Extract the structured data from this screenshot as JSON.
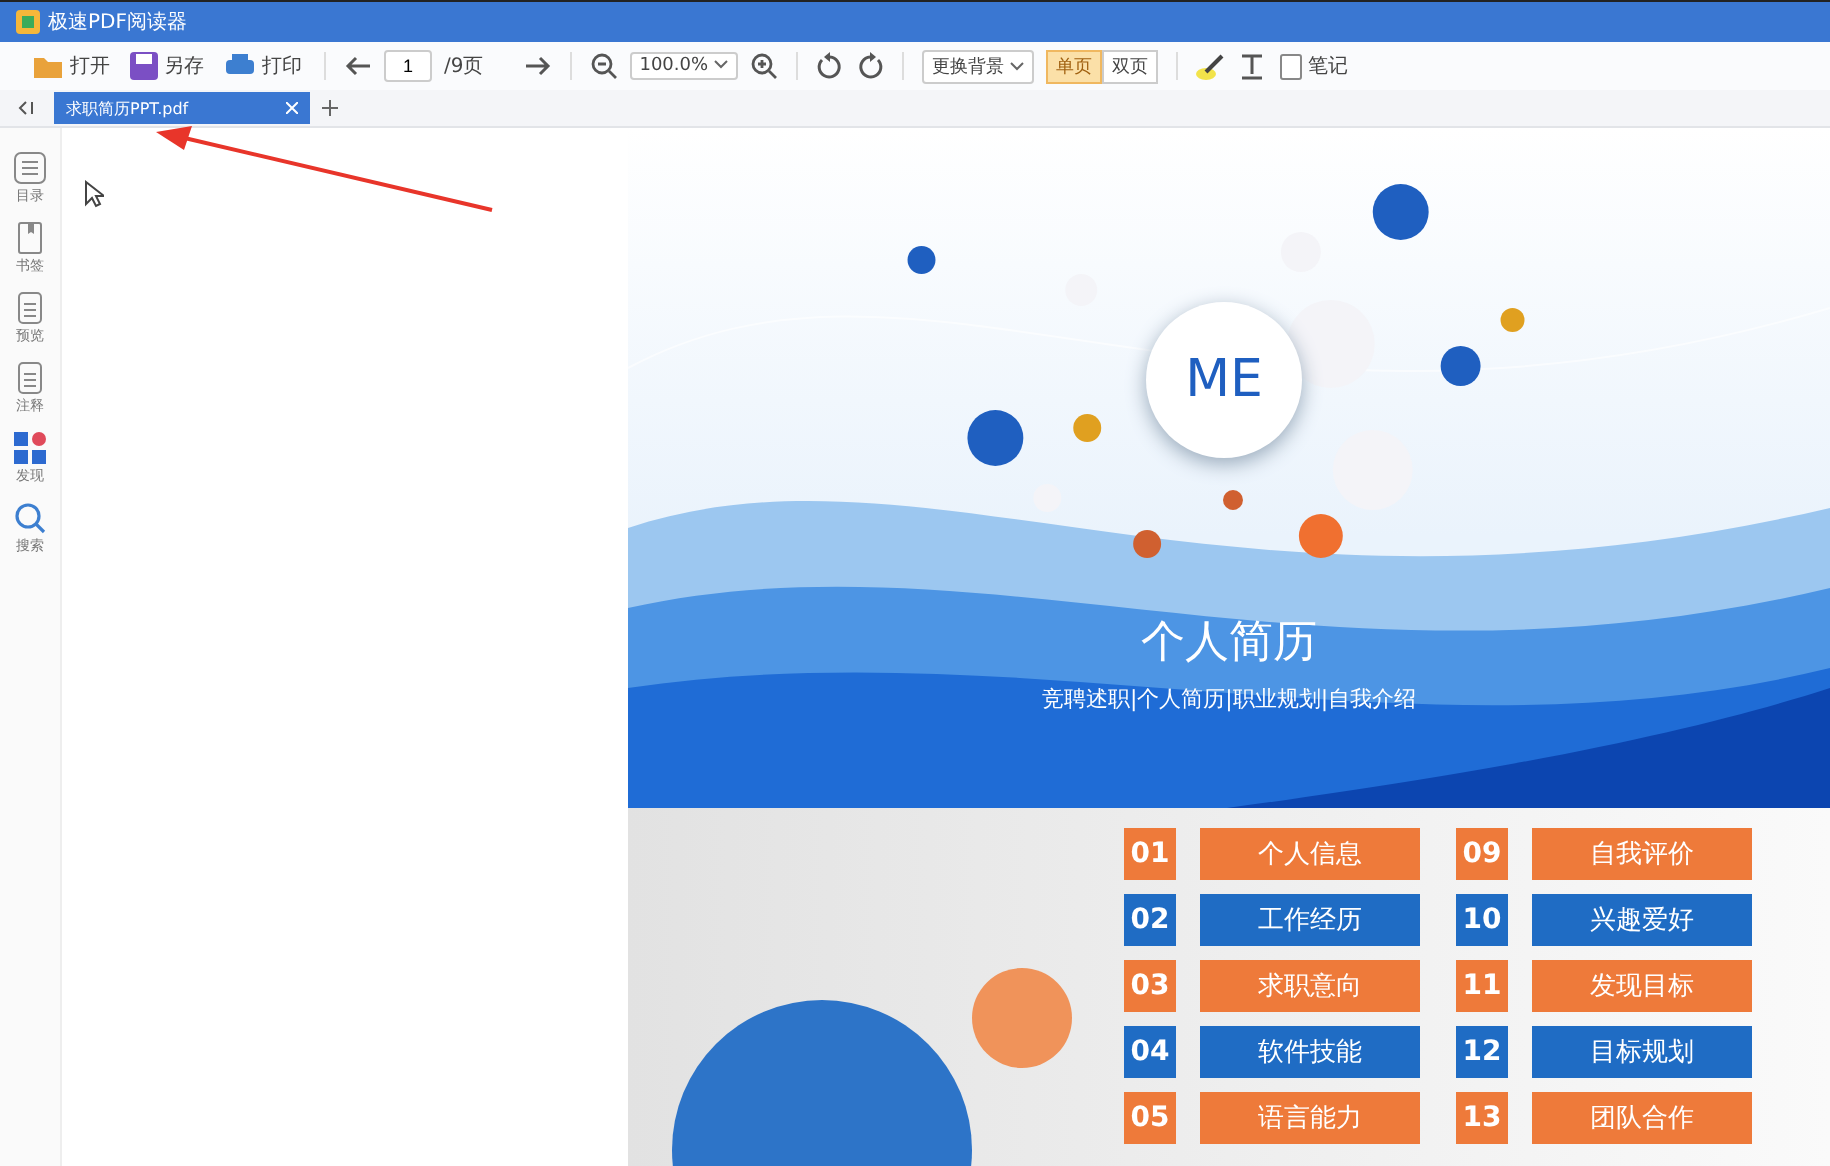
{
  "window": {
    "title": "极速PDF阅读器"
  },
  "toolbar": {
    "buttons": [
      {
        "kind": "open",
        "label": "打开"
      },
      {
        "kind": "save",
        "label": "另存"
      },
      {
        "kind": "print",
        "label": "打印"
      }
    ],
    "page": "1",
    "page_total": "/9页",
    "zoom": "100.0%",
    "background": "更换背景",
    "view_modes": [
      {
        "label": "单页",
        "selected": true
      },
      {
        "label": "双页",
        "selected": false
      }
    ],
    "note": "笔记"
  },
  "tabs": [
    {
      "label": "求职简历PPT.pdf",
      "selected": true
    }
  ],
  "sidebar": {
    "items": [
      {
        "kind": "toc",
        "label": "目录"
      },
      {
        "kind": "bookmark",
        "label": "书签"
      },
      {
        "kind": "preview",
        "label": "预览"
      },
      {
        "kind": "note",
        "label": "注释"
      },
      {
        "kind": "apps",
        "label": "发现"
      },
      {
        "kind": "search",
        "label": "搜索"
      }
    ]
  },
  "document": {
    "cover": {
      "badge": "ME",
      "title": "个人简历",
      "subtitle": "竞聘述职|个人简历|职业规划|自我介绍"
    },
    "contents": [
      [
        {
          "num": "01",
          "label": "个人信息",
          "color": "#ee7a3a"
        },
        {
          "num": "02",
          "label": "工作经历",
          "color": "#1f6cc4"
        },
        {
          "num": "03",
          "label": "求职意向",
          "color": "#ee7a3a"
        },
        {
          "num": "04",
          "label": "软件技能",
          "color": "#1f6cc4"
        },
        {
          "num": "05",
          "label": "语言能力",
          "color": "#ee7a3a"
        }
      ],
      [
        {
          "num": "09",
          "label": "自我评价",
          "color": "#ee7a3a"
        },
        {
          "num": "10",
          "label": "兴趣爱好",
          "color": "#1f6cc4"
        },
        {
          "num": "11",
          "label": "发现目标",
          "color": "#ee7a3a"
        },
        {
          "num": "12",
          "label": "目标规划",
          "color": "#1f6cc4"
        },
        {
          "num": "13",
          "label": "团队合作",
          "color": "#ee7a3a"
        }
      ]
    ]
  }
}
